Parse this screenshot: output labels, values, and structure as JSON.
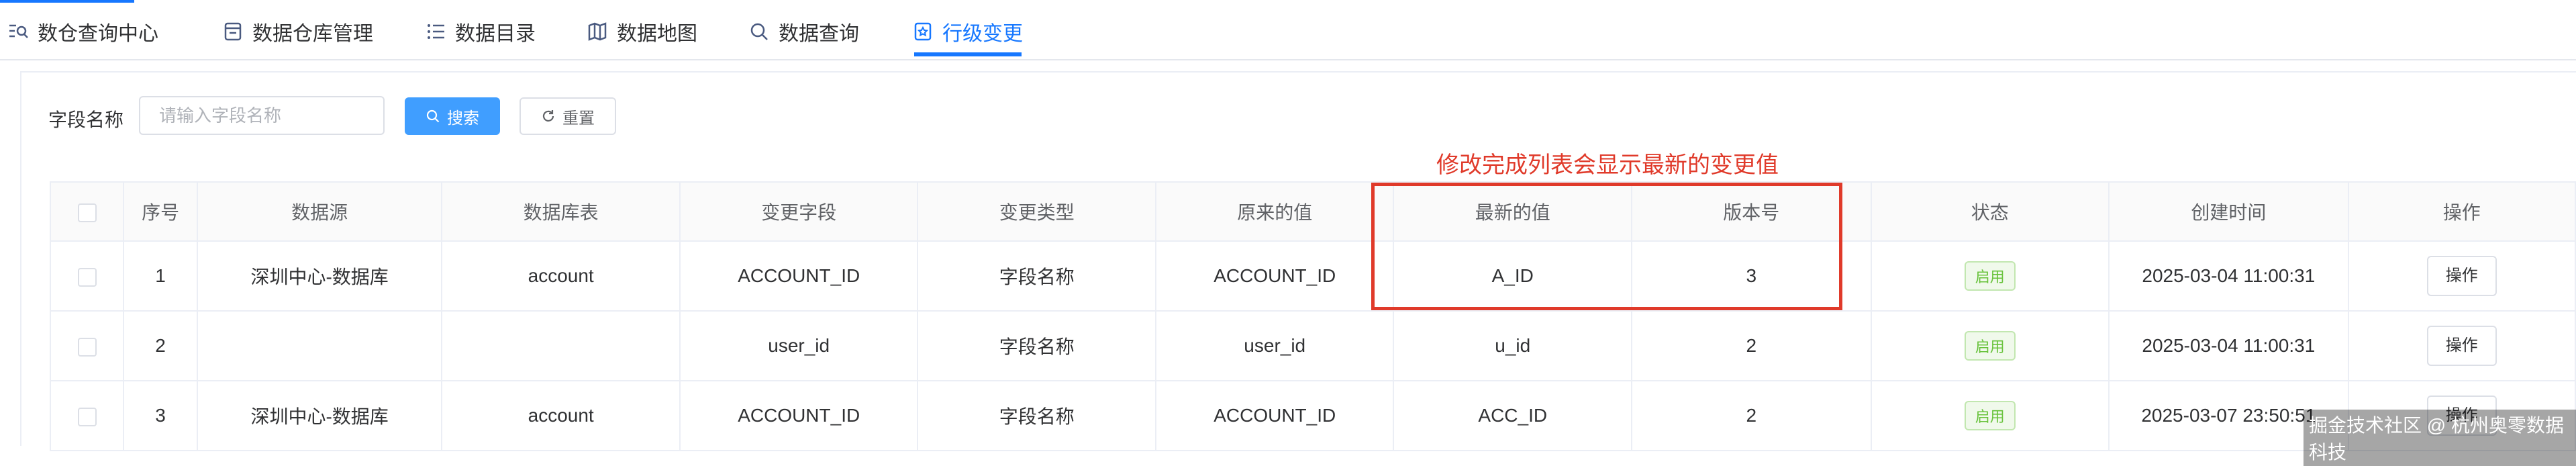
{
  "tabs": [
    {
      "label": "数仓查询中心",
      "icon": "data-search-icon"
    },
    {
      "label": "数据仓库管理",
      "icon": "database-icon"
    },
    {
      "label": "数据目录",
      "icon": "list-icon"
    },
    {
      "label": "数据地图",
      "icon": "map-icon"
    },
    {
      "label": "数据查询",
      "icon": "search-icon"
    },
    {
      "label": "行级变更",
      "icon": "row-change-icon"
    }
  ],
  "accent_color": "#1677ff",
  "filter": {
    "label": "字段名称",
    "placeholder": "请输入字段名称",
    "search_label": "搜索",
    "reset_label": "重置"
  },
  "annotation": "修改完成列表会显示最新的变更值",
  "table": {
    "headers": [
      "序号",
      "数据源",
      "数据库表",
      "变更字段",
      "变更类型",
      "原来的值",
      "最新的值",
      "版本号",
      "状态",
      "创建时间",
      "操作"
    ],
    "rows": [
      {
        "index": "1",
        "source": "深圳中心-数据库",
        "table": "account",
        "field": "ACCOUNT_ID",
        "type": "字段名称",
        "old": "ACCOUNT_ID",
        "new": "A_ID",
        "version": "3",
        "status": "启用",
        "created": "2025-03-04 11:00:31",
        "op": "操作"
      },
      {
        "index": "2",
        "source": "",
        "table": "",
        "field": "user_id",
        "type": "字段名称",
        "old": "user_id",
        "new": "u_id",
        "version": "2",
        "status": "启用",
        "created": "2025-03-04 11:00:31",
        "op": "操作"
      },
      {
        "index": "3",
        "source": "深圳中心-数据库",
        "table": "account",
        "field": "ACCOUNT_ID",
        "type": "字段名称",
        "old": "ACCOUNT_ID",
        "new": "ACC_ID",
        "version": "2",
        "status": "启用",
        "created": "2025-03-07 23:50:51",
        "op": "操作"
      }
    ]
  },
  "status_color": "#67c23a",
  "highlight_color": "#e03a2a",
  "watermark": "掘金技术社区 @ 杭州奥零数据科技"
}
